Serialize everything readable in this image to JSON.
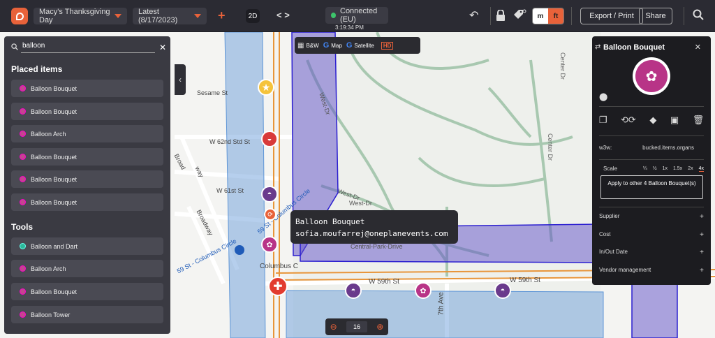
{
  "topbar": {
    "event": "Macy's Thanksgiving Day",
    "version": "Latest (8/17/2023)",
    "view_mode": "2D",
    "code_toggle": "< >",
    "connection": "Connected (EU)",
    "time": "3:19:34 PM",
    "unit_m": "m",
    "unit_ft": "ft",
    "export_label": "Export / Print",
    "share_label": "Share"
  },
  "map": {
    "controls": {
      "bw": "B&W",
      "map": "Map",
      "satellite": "Satellite",
      "hd": "HD"
    },
    "labels": [
      "Sesame St",
      "W 62nd Std St",
      "W 61st St",
      "Broadway",
      "Broad",
      "way",
      "59 St - Columbus Circle",
      "59 St - Columbus Circle",
      "West-Dr",
      "West-Dr",
      "West-Dr",
      "Central-Park-Drive",
      "Columbus C",
      "W 59th St",
      "W 59th St",
      "7th Ave",
      "Center Dr",
      "Center Dr"
    ],
    "zoom": "16",
    "tooltip": {
      "name": "Balloon Bouquet",
      "email": "sofia.moufarrej@oneplanevents.com"
    }
  },
  "left_panel": {
    "search_value": "balloon",
    "placed_title": "Placed items",
    "placed_items": [
      "Balloon Bouquet",
      "Balloon Bouquet",
      "Balloon Arch",
      "Balloon Bouquet",
      "Balloon Bouquet",
      "Balloon Bouquet"
    ],
    "tools_title": "Tools",
    "tools": [
      "Balloon and Dart",
      "Balloon Arch",
      "Balloon Bouquet",
      "Balloon Tower"
    ]
  },
  "right_panel": {
    "title": "Balloon Bouquet",
    "w3w_label": "w3w:",
    "w3w_value": "bucked.items.organs",
    "scale_label": "Scale",
    "scale_options": [
      "¼",
      "½",
      "1x",
      "1.5x",
      "2x",
      "4x"
    ],
    "scale_active": "4x",
    "apply_label": "Apply to other 4 Balloon Bouquet(s)",
    "sections": [
      "Supplier",
      "Cost",
      "In/Out Date",
      "Vendor management"
    ],
    "plus": "+"
  },
  "colors": {
    "accent": "#e8623a",
    "panel": "#3a3a42",
    "bouquet": "#b83487",
    "zone_blue": "#5e95d6",
    "zone_purple": "#5f50c8"
  }
}
